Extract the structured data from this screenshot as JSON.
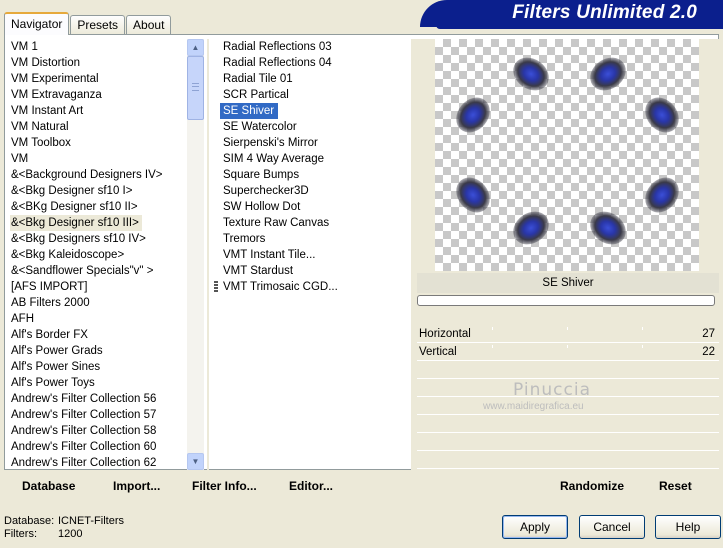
{
  "tabs": [
    {
      "label": "Navigator",
      "active": true
    },
    {
      "label": "Presets",
      "active": false
    },
    {
      "label": "About",
      "active": false
    }
  ],
  "banner": {
    "title": "Filters Unlimited 2.0"
  },
  "categories": [
    "VM 1",
    "VM Distortion",
    "VM Experimental",
    "VM Extravaganza",
    "VM Instant Art",
    "VM Natural",
    "VM Toolbox",
    "VM",
    "&<Background Designers IV>",
    "&<Bkg Designer sf10 I>",
    "&<BKg Designer sf10 II>",
    "&<Bkg Designer sf10 III>",
    "&<Bkg Designers sf10 IV>",
    "&<Bkg Kaleidoscope>",
    "&<Sandflower Specials\"v\" >",
    "[AFS IMPORT]",
    "AB Filters 2000",
    "AFH",
    "Alf's Border FX",
    "Alf's Power Grads",
    "Alf's Power Sines",
    "Alf's Power Toys",
    "Andrew's Filter Collection 56",
    "Andrew's Filter Collection 57",
    "Andrew's Filter Collection 58",
    "Andrew's Filter Collection 60",
    "Andrew's Filter Collection 62"
  ],
  "selected_category_index": 11,
  "filters": [
    "Radial Reflections 03",
    "Radial Reflections 04",
    "Radial Tile 01",
    "SCR  Partical",
    "SE Shiver",
    "SE Watercolor",
    "Sierpenski's Mirror",
    "SIM 4 Way Average",
    "Square Bumps",
    "Superchecker3D",
    "SW Hollow Dot",
    "Texture Raw Canvas",
    "Tremors",
    "VMT Instant Tile...",
    "VMT Stardust",
    "VMT Trimosaic CGD..."
  ],
  "selected_filter_index": 4,
  "preview": {
    "filter_name": "SE Shiver",
    "progress": 0
  },
  "params": [
    {
      "label": "Horizontal",
      "value": "27"
    },
    {
      "label": "Vertical",
      "value": "22"
    }
  ],
  "watermark": {
    "name": "Pinuccia",
    "url": "www.maidiregrafica.eu"
  },
  "actions": {
    "database": "Database",
    "import": "Import...",
    "filter_info": "Filter Info...",
    "editor": "Editor...",
    "randomize": "Randomize",
    "reset": "Reset"
  },
  "status": {
    "database_label": "Database:",
    "database_value": "ICNET-Filters",
    "filters_label": "Filters:",
    "filters_value": "1200"
  },
  "buttons": {
    "apply": "Apply",
    "cancel": "Cancel",
    "help": "Help"
  },
  "colors": {
    "banner": "#0b1f8d",
    "selection": "#316ac5",
    "window": "#ece9d8"
  }
}
